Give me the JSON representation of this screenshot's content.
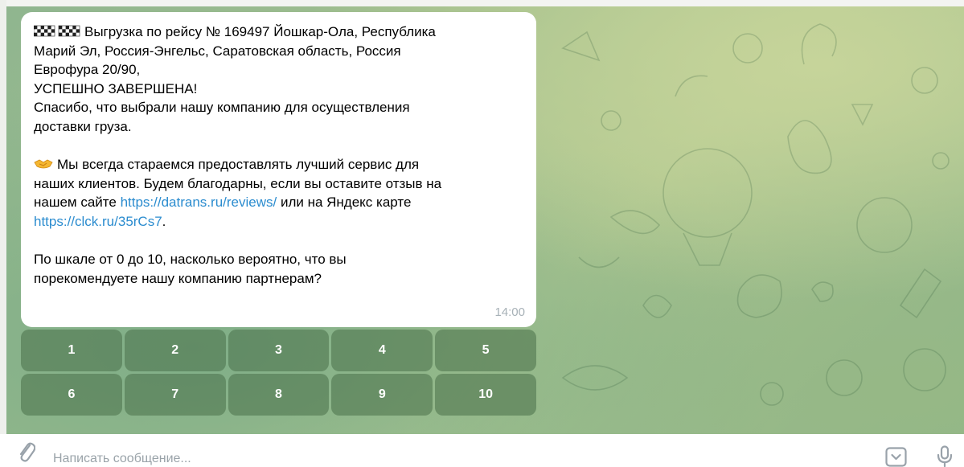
{
  "message": {
    "line1": "Выгрузка по рейсу № 169497 Йошкар-Ола, Республика",
    "line2": "Марий Эл, Россия-Энгельс, Саратовская область, Россия",
    "line3": "Еврофура 20/90,",
    "line4": "УСПЕШНО ЗАВЕРШЕНА!",
    "line5": "Спасибо, что выбрали нашу компанию для осуществления",
    "line6": "доставки груза.",
    "line7": "Мы всегда стараемся предоставлять лучший сервис для",
    "line8": "наших клиентов. Будем благодарны, если вы оставите отзыв на",
    "line9_prefix": "нашем сайте ",
    "link_site": "https://datrans.ru/reviews/",
    "line9_suffix": " или на Яндекс карте",
    "link_map": "https://clck.ru/35rCs7",
    "line10_suffix": ".",
    "line11": "По шкале от 0 до 10, насколько вероятно, что вы",
    "line12": "порекомендуете нашу компанию партнерам?",
    "time": "14:00"
  },
  "keyboard": {
    "row1": [
      "1",
      "2",
      "3",
      "4",
      "5"
    ],
    "row2": [
      "6",
      "7",
      "8",
      "9",
      "10"
    ]
  },
  "composer": {
    "placeholder": "Написать сообщение..."
  },
  "icons": {
    "flags": "checkered-flags-icon",
    "handshake": "handshake-icon",
    "attach": "paperclip-icon",
    "bot_commands": "bot-keyboard-icon",
    "mic": "microphone-icon"
  },
  "colors": {
    "link": "#2b8ccf",
    "keyboard_button": "#5b875b",
    "timestamp": "#a7b1b7",
    "placeholder": "#9aa3a9"
  }
}
